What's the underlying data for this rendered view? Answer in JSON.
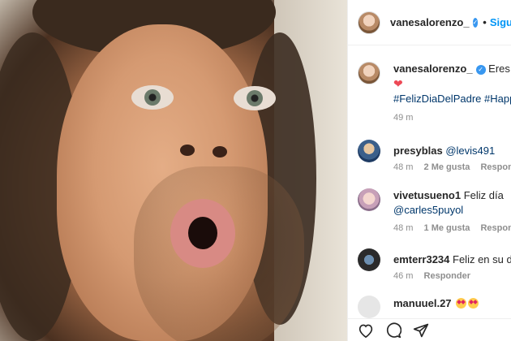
{
  "post": {
    "author": "vanesalorenzo_",
    "follow_label": "Siguien",
    "caption_text": "Eres muy",
    "caption_hashtags": "#FelizDiaDelPadre #HappyF",
    "caption_time": "49 m"
  },
  "comments": [
    {
      "user": "presyblas",
      "text": "@levis491",
      "time": "48 m",
      "likes": "2 Me gusta",
      "reply": "Responder"
    },
    {
      "user": "vivetusueno1",
      "text": "Feliz día",
      "mention": "@carles5puyol",
      "time": "48 m",
      "likes": "1 Me gusta",
      "reply": "Responder"
    },
    {
      "user": "emterr3234",
      "text": "Feliz en su día F",
      "time": "46 m",
      "reply": "Responder"
    },
    {
      "user": "manuuel.27"
    }
  ],
  "icons": {
    "verified": "verified-badge-icon",
    "heart": "heart-emoji-icon",
    "heart_eyes": "heart-eyes-emoji-icon",
    "like": "heart-outline-icon",
    "comment": "comment-icon",
    "share": "paper-plane-icon"
  },
  "colors": {
    "verified": "#3897f0",
    "follow": "#0095f6",
    "link": "#00376b",
    "muted": "#8e8e8e",
    "heart": "#ed4956"
  }
}
